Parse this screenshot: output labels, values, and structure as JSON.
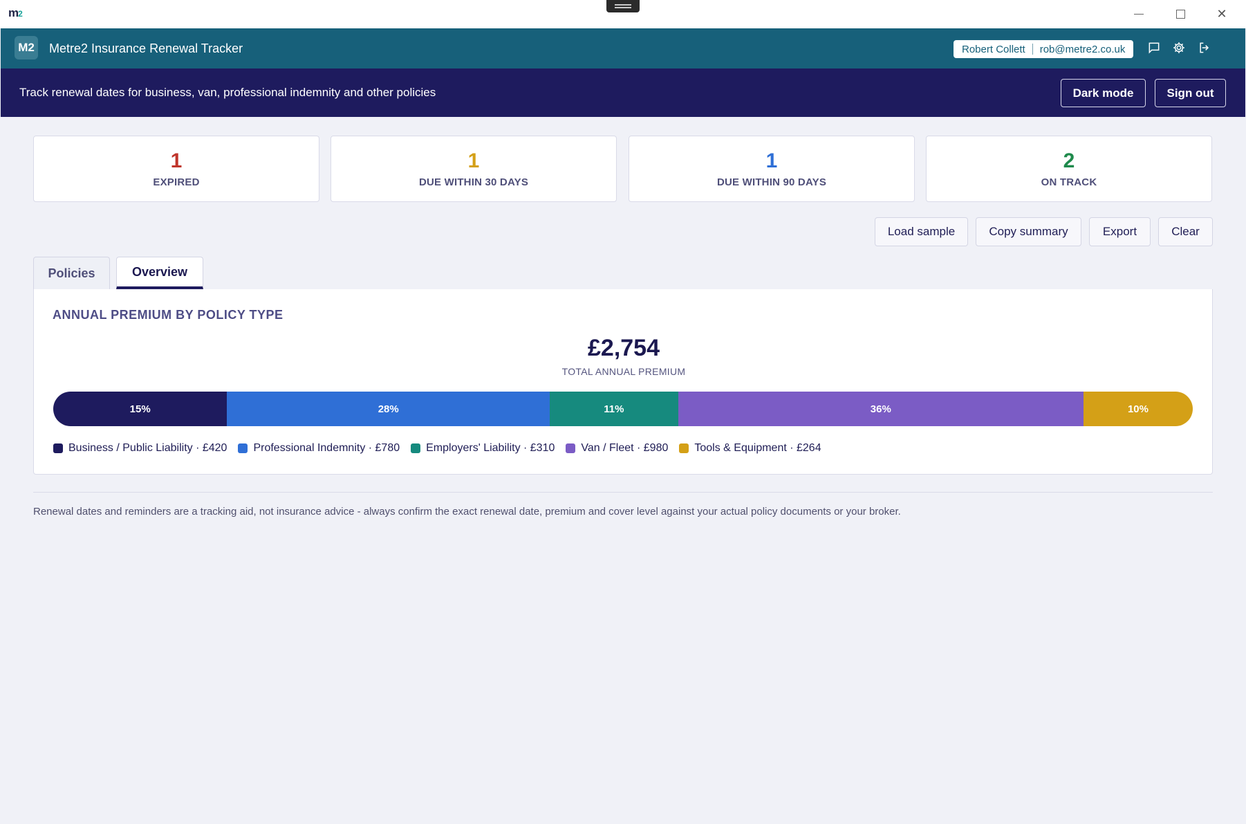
{
  "os": {
    "logo_main": "m",
    "logo_sup": "2"
  },
  "header": {
    "badge": "M2",
    "title": "Metre2 Insurance Renewal Tracker",
    "user_name": "Robert Collett",
    "user_email": "rob@metre2.co.uk",
    "icons": [
      "chat-icon",
      "gear-icon",
      "logout-icon"
    ]
  },
  "banner": {
    "text": "Track renewal dates for business, van, professional indemnity and other policies",
    "dark_mode_label": "Dark mode",
    "sign_out_label": "Sign out"
  },
  "stats": [
    {
      "value": "1",
      "label": "EXPIRED",
      "color": "#c0362c"
    },
    {
      "value": "1",
      "label": "DUE WITHIN 30 DAYS",
      "color": "#d4a017"
    },
    {
      "value": "1",
      "label": "DUE WITHIN 90 DAYS",
      "color": "#2f6fd6"
    },
    {
      "value": "2",
      "label": "ON TRACK",
      "color": "#1f8a4c"
    }
  ],
  "actions": {
    "load_sample": "Load sample",
    "copy_summary": "Copy summary",
    "export": "Export",
    "clear": "Clear"
  },
  "tabs": [
    {
      "label": "Policies",
      "active": false
    },
    {
      "label": "Overview",
      "active": true
    }
  ],
  "overview": {
    "title": "ANNUAL PREMIUM BY POLICY TYPE",
    "total_value": "£2,754",
    "total_label": "TOTAL ANNUAL PREMIUM"
  },
  "chart_data": {
    "type": "bar",
    "stacked": true,
    "orientation": "horizontal",
    "title": "ANNUAL PREMIUM BY POLICY TYPE",
    "total": 2754,
    "series": [
      {
        "name": "Business / Public Liability",
        "value": 420,
        "percent": 15,
        "pct_label": "15%",
        "legend": "Business / Public Liability · £420",
        "color": "#1e1b5e"
      },
      {
        "name": "Professional Indemnity",
        "value": 780,
        "percent": 28,
        "pct_label": "28%",
        "legend": "Professional Indemnity · £780",
        "color": "#2f6fd6"
      },
      {
        "name": "Employers' Liability",
        "value": 310,
        "percent": 11,
        "pct_label": "11%",
        "legend": "Employers' Liability · £310",
        "color": "#168a7e"
      },
      {
        "name": "Van / Fleet",
        "value": 980,
        "percent": 36,
        "pct_label": "36%",
        "legend": "Van / Fleet · £980",
        "color": "#7b5cc5"
      },
      {
        "name": "Tools & Equipment",
        "value": 264,
        "percent": 10,
        "pct_label": "10%",
        "legend": "Tools & Equipment · £264",
        "color": "#d4a017"
      }
    ]
  },
  "footer": {
    "disclaimer": "Renewal dates and reminders are a tracking aid, not insurance advice - always confirm the exact renewal date, premium and cover level against your actual policy documents or your broker."
  }
}
